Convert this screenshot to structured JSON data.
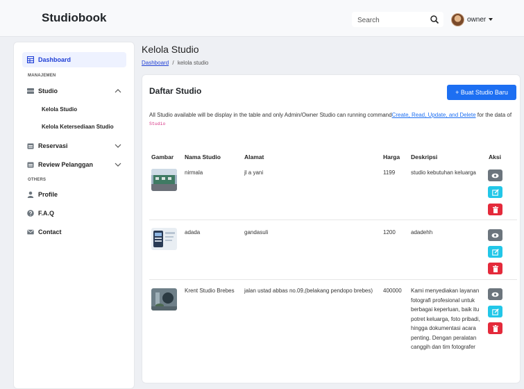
{
  "app": {
    "brand": "Studiobook"
  },
  "header": {
    "search_placeholder": "Search",
    "user_name": "owner"
  },
  "sidebar": {
    "dashboard": "Dashboard",
    "section_manajemen": "MANAJEMEN",
    "studio": "Studio",
    "kelola_studio": "Kelola Studio",
    "kelola_ketersediaan": "Kelola Ketersediaan Studio",
    "reservasi": "Reservasi",
    "review": "Review Pelanggan",
    "section_others": "OTHERS",
    "profile": "Profile",
    "faq": "F.A.Q",
    "contact": "Contact"
  },
  "page": {
    "title": "Kelola Studio",
    "breadcrumb_home": "Dashboard",
    "breadcrumb_sep": "/",
    "breadcrumb_current": "kelola studio"
  },
  "card": {
    "title": "Daftar Studio",
    "new_button": "+ Buat Studio Baru",
    "desc_1": "All Studio available will be display in the table and only Admin/Owner Studio can running command",
    "desc_link": "Create, Read, Update, and Delete",
    "desc_2": " for the data of ",
    "desc_code": "Studio"
  },
  "table": {
    "headers": [
      "Gambar",
      "Nama Studio",
      "Alamat",
      "Harga",
      "Deskripsi",
      "Aksi"
    ],
    "rows": [
      {
        "name": "nirmala",
        "address": "jl a yani",
        "price": "1199",
        "description": "studio kebutuhan keluarga"
      },
      {
        "name": "adada",
        "address": "gandasuli",
        "price": "1200",
        "description": "adadehh"
      },
      {
        "name": "Krent Studio Brebes",
        "address": "jalan ustad abbas no.09,(belakang pendopo brebes)",
        "price": "400000",
        "description": "Kami menyediakan layanan fotografi profesional untuk berbagai keperluan, baik itu potret keluarga, foto pribadi, hingga dokumentasi acara penting. Dengan peralatan canggih dan tim fotografer"
      }
    ]
  },
  "colors": {
    "primary": "#1d6ff2",
    "info": "#22c7e8",
    "danger": "#e42a3b",
    "secondary": "#6c757d"
  }
}
